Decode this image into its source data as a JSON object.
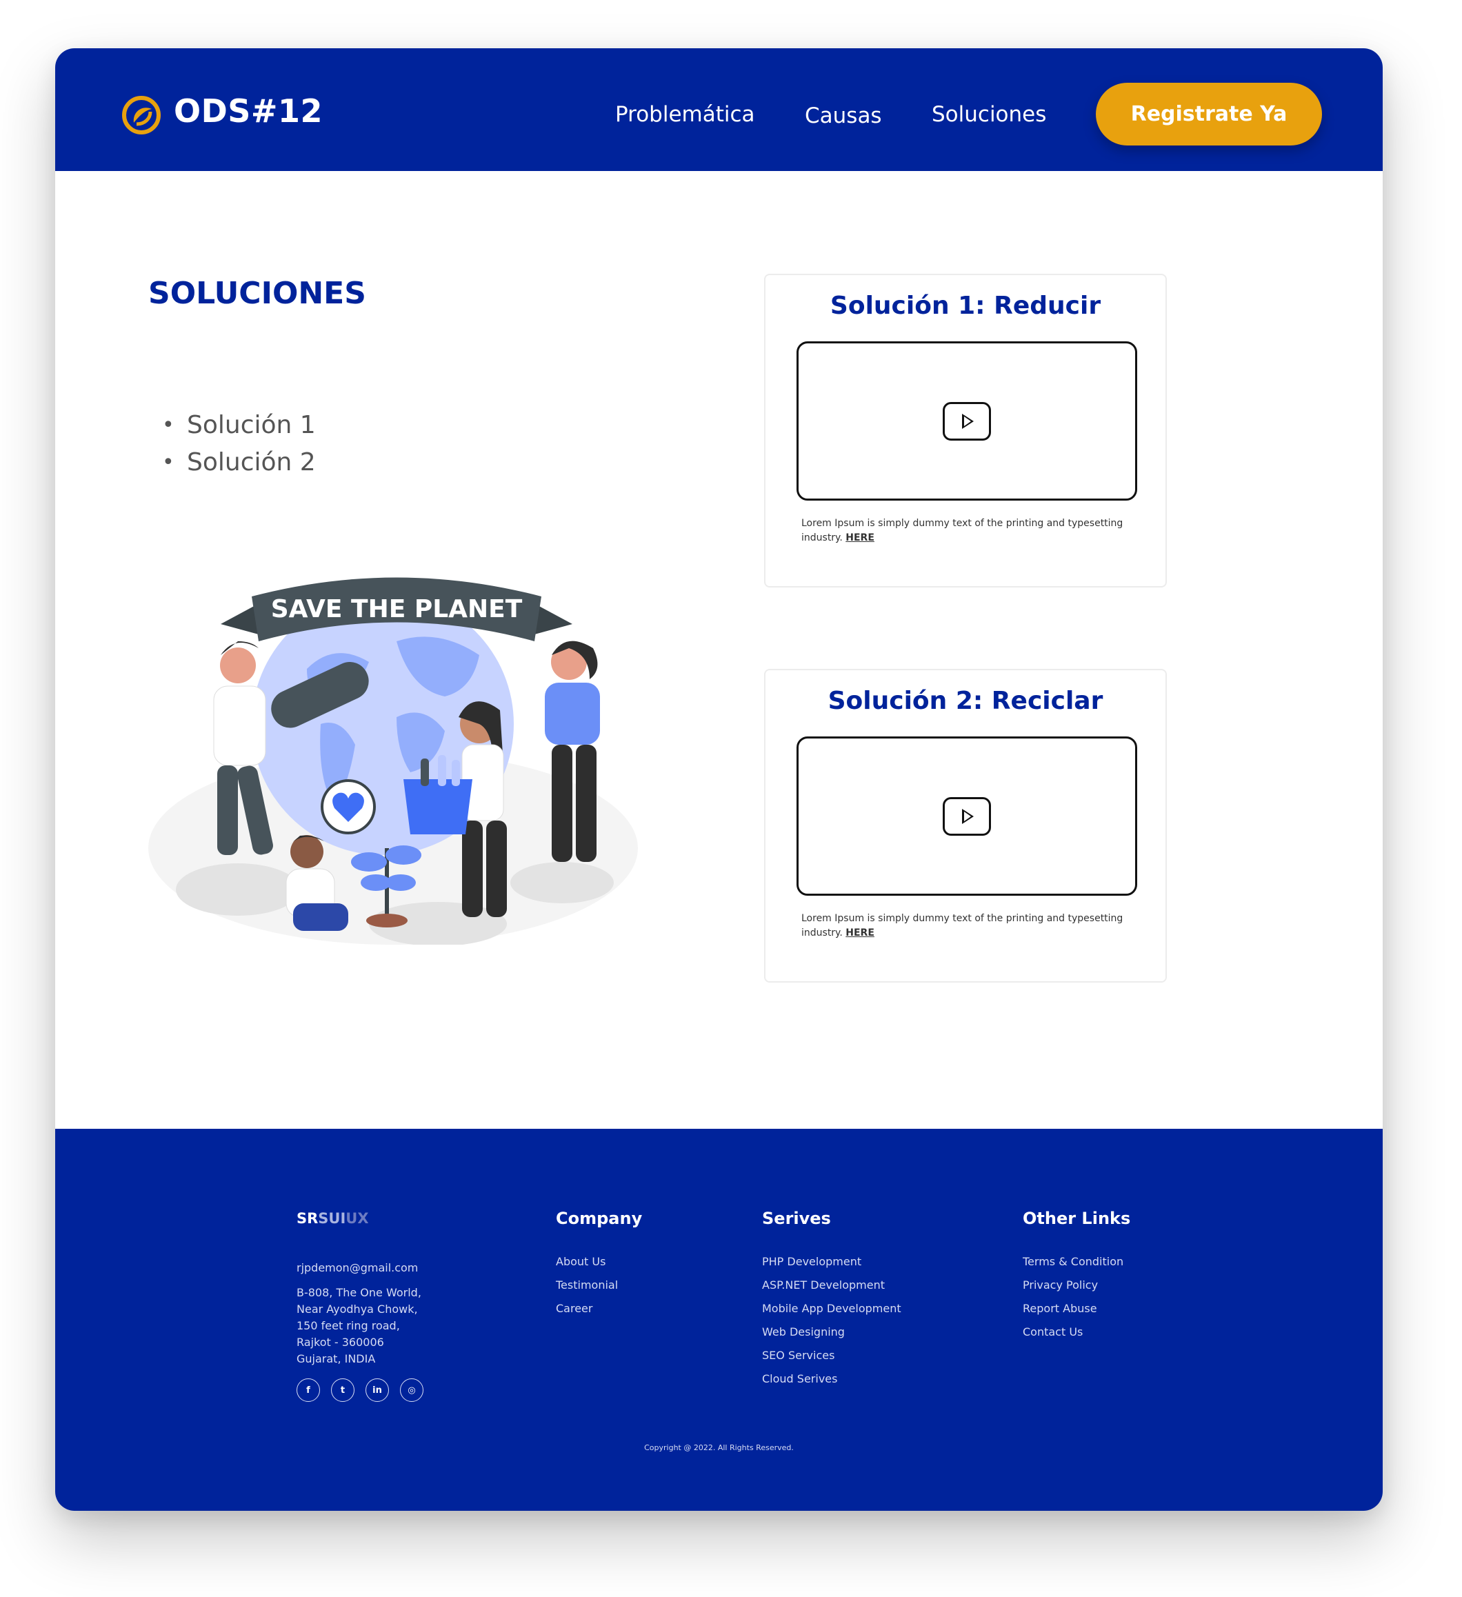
{
  "nav": {
    "brand": "ODS#12",
    "links": [
      "Problemática",
      "Causas",
      "Soluciones"
    ],
    "cta_label": "Registrate Ya"
  },
  "main": {
    "title": "SOLUCIONES",
    "list": [
      "Solución 1",
      "Solución 2"
    ],
    "illustration_banner": "SAVE THE PLANET",
    "cards": [
      {
        "title": "Solución 1: Reducir",
        "text": "Lorem Ipsum is simply dummy text of the printing and typesetting industry.",
        "link": "HERE"
      },
      {
        "title": "Solución 2: Reciclar",
        "text": "Lorem Ipsum is simply dummy text of the printing and typesetting industry.",
        "link": "HERE"
      }
    ]
  },
  "footer": {
    "brand": {
      "part1": "SR",
      "part2": "SUI",
      "part3": "UX"
    },
    "email": "rjpdemon@gmail.com",
    "address": [
      "B-808, The One World,",
      "Near Ayodhya Chowk,",
      "150 feet ring road,",
      "Rajkot - 360006",
      "Gujarat, INDIA"
    ],
    "social": [
      {
        "icon": "facebook-icon",
        "glyph": "f"
      },
      {
        "icon": "twitter-icon",
        "glyph": "t"
      },
      {
        "icon": "linkedin-icon",
        "glyph": "in"
      },
      {
        "icon": "instagram-icon",
        "glyph": "◎"
      }
    ],
    "company": {
      "heading": "Company",
      "items": [
        "About Us",
        "Testimonial",
        "Career"
      ]
    },
    "services": {
      "heading": "Serives",
      "items": [
        "PHP Development",
        "ASP.NET Development",
        "Mobile App Development",
        "Web Designing",
        "SEO Services",
        "Cloud Serives"
      ]
    },
    "other": {
      "heading": "Other Links",
      "items": [
        "Terms & Condition",
        "Privacy Policy",
        "Report Abuse",
        "Contact Us"
      ]
    },
    "copyright": "Copyright @  2022. All Rights Reserved."
  },
  "colors": {
    "primary": "#00239B",
    "accent": "#E8A10E"
  }
}
